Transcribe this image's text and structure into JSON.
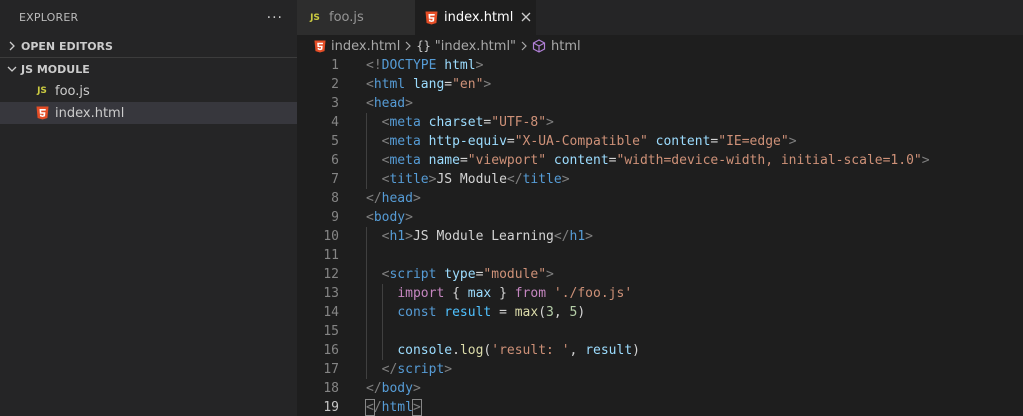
{
  "explorer": {
    "title": "EXPLORER",
    "more_label": "···",
    "open_editors_label": "OPEN EDITORS",
    "folder_label": "JS MODULE",
    "files": [
      {
        "name": "foo.js",
        "icon": "js-file-icon",
        "selected": false
      },
      {
        "name": "index.html",
        "icon": "html-file-icon",
        "selected": true
      }
    ]
  },
  "tabs": [
    {
      "label": "foo.js",
      "icon": "js-file-icon",
      "active": false
    },
    {
      "label": "index.html",
      "icon": "html-file-icon",
      "active": true
    }
  ],
  "breadcrumb": {
    "file": "index.html",
    "element": "\"index.html\"",
    "symbol": "html"
  },
  "colors": {
    "html_icon": "#e44d26",
    "js_icon": "#cbcb41",
    "symbol_icon": "#b180d7"
  },
  "editor": {
    "current_line": 19,
    "lines": [
      [
        [
          "<!",
          "t-punct"
        ],
        [
          "DOCTYPE",
          "t-tag"
        ],
        [
          " ",
          "t-text"
        ],
        [
          "html",
          "t-attr"
        ],
        [
          ">",
          "t-punct"
        ]
      ],
      [
        [
          "<",
          "t-punct"
        ],
        [
          "html",
          "t-tag"
        ],
        [
          " ",
          "t-text"
        ],
        [
          "lang",
          "t-attr"
        ],
        [
          "=",
          "t-text"
        ],
        [
          "\"en\"",
          "t-str"
        ],
        [
          ">",
          "t-punct"
        ]
      ],
      [
        [
          "<",
          "t-punct"
        ],
        [
          "head",
          "t-tag"
        ],
        [
          ">",
          "t-punct"
        ]
      ],
      [
        [
          "  ",
          "t-text"
        ],
        [
          "<",
          "t-punct"
        ],
        [
          "meta",
          "t-tag"
        ],
        [
          " ",
          "t-text"
        ],
        [
          "charset",
          "t-attr"
        ],
        [
          "=",
          "t-text"
        ],
        [
          "\"UTF-8\"",
          "t-str"
        ],
        [
          ">",
          "t-punct"
        ]
      ],
      [
        [
          "  ",
          "t-text"
        ],
        [
          "<",
          "t-punct"
        ],
        [
          "meta",
          "t-tag"
        ],
        [
          " ",
          "t-text"
        ],
        [
          "http-equiv",
          "t-attr"
        ],
        [
          "=",
          "t-text"
        ],
        [
          "\"X-UA-Compatible\"",
          "t-str"
        ],
        [
          " ",
          "t-text"
        ],
        [
          "content",
          "t-attr"
        ],
        [
          "=",
          "t-text"
        ],
        [
          "\"IE=edge\"",
          "t-str"
        ],
        [
          ">",
          "t-punct"
        ]
      ],
      [
        [
          "  ",
          "t-text"
        ],
        [
          "<",
          "t-punct"
        ],
        [
          "meta",
          "t-tag"
        ],
        [
          " ",
          "t-text"
        ],
        [
          "name",
          "t-attr"
        ],
        [
          "=",
          "t-text"
        ],
        [
          "\"viewport\"",
          "t-str"
        ],
        [
          " ",
          "t-text"
        ],
        [
          "content",
          "t-attr"
        ],
        [
          "=",
          "t-text"
        ],
        [
          "\"width=device-width, initial-scale=1.0\"",
          "t-str"
        ],
        [
          ">",
          "t-punct"
        ]
      ],
      [
        [
          "  ",
          "t-text"
        ],
        [
          "<",
          "t-punct"
        ],
        [
          "title",
          "t-tag"
        ],
        [
          ">",
          "t-punct"
        ],
        [
          "JS Module",
          "t-text"
        ],
        [
          "</",
          "t-punct"
        ],
        [
          "title",
          "t-tag"
        ],
        [
          ">",
          "t-punct"
        ]
      ],
      [
        [
          "</",
          "t-punct"
        ],
        [
          "head",
          "t-tag"
        ],
        [
          ">",
          "t-punct"
        ]
      ],
      [
        [
          "<",
          "t-punct"
        ],
        [
          "body",
          "t-tag"
        ],
        [
          ">",
          "t-punct"
        ]
      ],
      [
        [
          "  ",
          "t-text"
        ],
        [
          "<",
          "t-punct"
        ],
        [
          "h1",
          "t-tag"
        ],
        [
          ">",
          "t-punct"
        ],
        [
          "JS Module Learning",
          "t-text"
        ],
        [
          "</",
          "t-punct"
        ],
        [
          "h1",
          "t-tag"
        ],
        [
          ">",
          "t-punct"
        ]
      ],
      [],
      [
        [
          "  ",
          "t-text"
        ],
        [
          "<",
          "t-punct"
        ],
        [
          "script",
          "t-tag"
        ],
        [
          " ",
          "t-text"
        ],
        [
          "type",
          "t-attr"
        ],
        [
          "=",
          "t-text"
        ],
        [
          "\"module\"",
          "t-str"
        ],
        [
          ">",
          "t-punct"
        ]
      ],
      [
        [
          "    ",
          "t-text"
        ],
        [
          "import",
          "t-kw"
        ],
        [
          " { ",
          "t-text"
        ],
        [
          "max",
          "t-var"
        ],
        [
          " } ",
          "t-text"
        ],
        [
          "from",
          "t-kw"
        ],
        [
          " ",
          "t-text"
        ],
        [
          "'./foo.js'",
          "t-str"
        ]
      ],
      [
        [
          "    ",
          "t-text"
        ],
        [
          "const",
          "t-store"
        ],
        [
          " ",
          "t-text"
        ],
        [
          "result",
          "t-const"
        ],
        [
          " = ",
          "t-text"
        ],
        [
          "max",
          "t-fn"
        ],
        [
          "(",
          "t-text"
        ],
        [
          "3",
          "t-num"
        ],
        [
          ", ",
          "t-text"
        ],
        [
          "5",
          "t-num"
        ],
        [
          ")",
          "t-text"
        ]
      ],
      [],
      [
        [
          "    ",
          "t-text"
        ],
        [
          "console",
          "t-var"
        ],
        [
          ".",
          "t-text"
        ],
        [
          "log",
          "t-fn"
        ],
        [
          "(",
          "t-text"
        ],
        [
          "'result: '",
          "t-str"
        ],
        [
          ", ",
          "t-text"
        ],
        [
          "result",
          "t-var"
        ],
        [
          ")",
          "t-text"
        ]
      ],
      [
        [
          "  ",
          "t-text"
        ],
        [
          "</",
          "t-punct"
        ],
        [
          "script",
          "t-tag"
        ],
        [
          ">",
          "t-punct"
        ]
      ],
      [
        [
          "</",
          "t-punct"
        ],
        [
          "body",
          "t-tag"
        ],
        [
          ">",
          "t-punct"
        ]
      ],
      [
        [
          "<",
          "t-punct bracket-box"
        ],
        [
          "/",
          "t-punct"
        ],
        [
          "html",
          "t-tag"
        ],
        [
          ">",
          "t-punct bracket-box"
        ]
      ]
    ]
  }
}
